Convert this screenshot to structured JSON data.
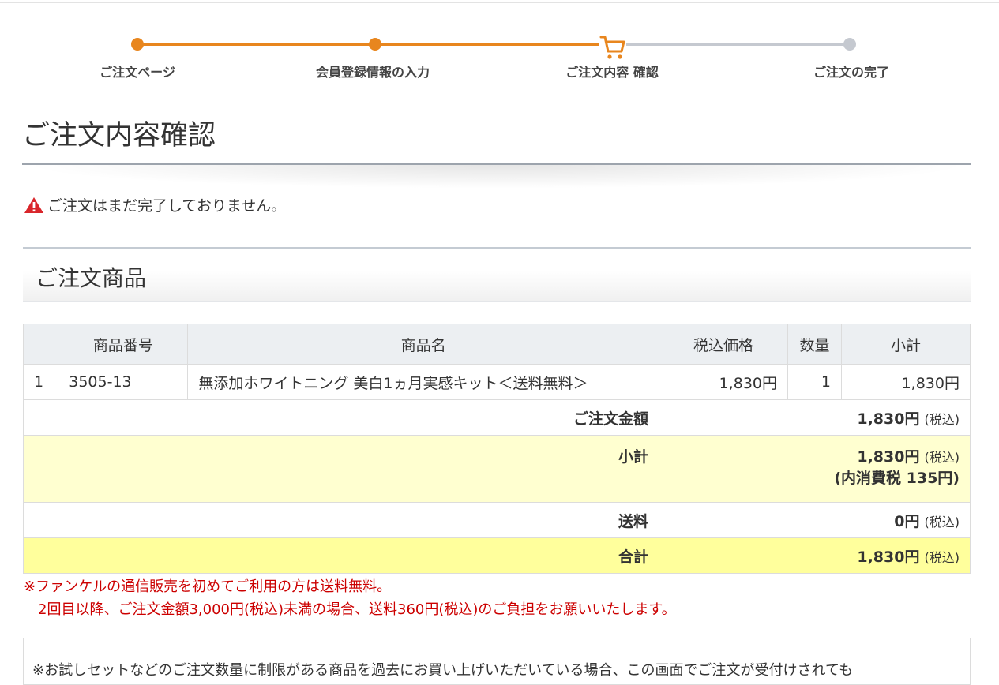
{
  "stepper": {
    "steps": [
      "ご注文ページ",
      "会員登録情報の入力",
      "ご注文内容 確認",
      "ご注文の完了"
    ],
    "current_step": 3,
    "colors": {
      "done": "#e8861e",
      "todo": "#c5c9d0"
    }
  },
  "page": {
    "title": "ご注文内容確認",
    "warning": "ご注文はまだ完了しておりません。"
  },
  "section": {
    "title": "ご注文商品"
  },
  "table": {
    "headers": [
      "",
      "商品番号",
      "商品名",
      "税込価格",
      "数量",
      "小計"
    ],
    "rows": [
      {
        "no": "1",
        "code": "3505-13",
        "name": "無添加ホワイトニング 美白1ヵ月実感キット＜送料無料＞",
        "price": "1,830円",
        "qty": "1",
        "subtotal": "1,830円"
      }
    ]
  },
  "summary": {
    "order_amount": {
      "label": "ご注文金額",
      "value": "1,830円",
      "tax": "(税込)"
    },
    "subtotal": {
      "label": "小計",
      "value": "1,830円",
      "tax": "(税込)",
      "consumption_tax": "(内消費税 135円)"
    },
    "shipping": {
      "label": "送料",
      "value": "0円",
      "tax": "(税込)"
    },
    "total": {
      "label": "合計",
      "value": "1,830円",
      "tax": "(税込)"
    }
  },
  "notes": {
    "line1": "※ファンケルの通信販売を初めてご利用の方は送料無料。",
    "line2": "2回目以降、ご注文金額3,000円(税込)未満の場合、送料360円(税込)のご負担をお願いいたします。"
  },
  "info": {
    "text": "※お試しセットなどのご注文数量に制限がある商品を過去にお買い上げいただいている場合、この画面でご注文が受付けされても"
  },
  "colors": {
    "accent": "#e8861e",
    "warning_red": "#cc0000",
    "highlight_pale": "#ffffd0",
    "highlight_yellow": "#ffff9c"
  }
}
